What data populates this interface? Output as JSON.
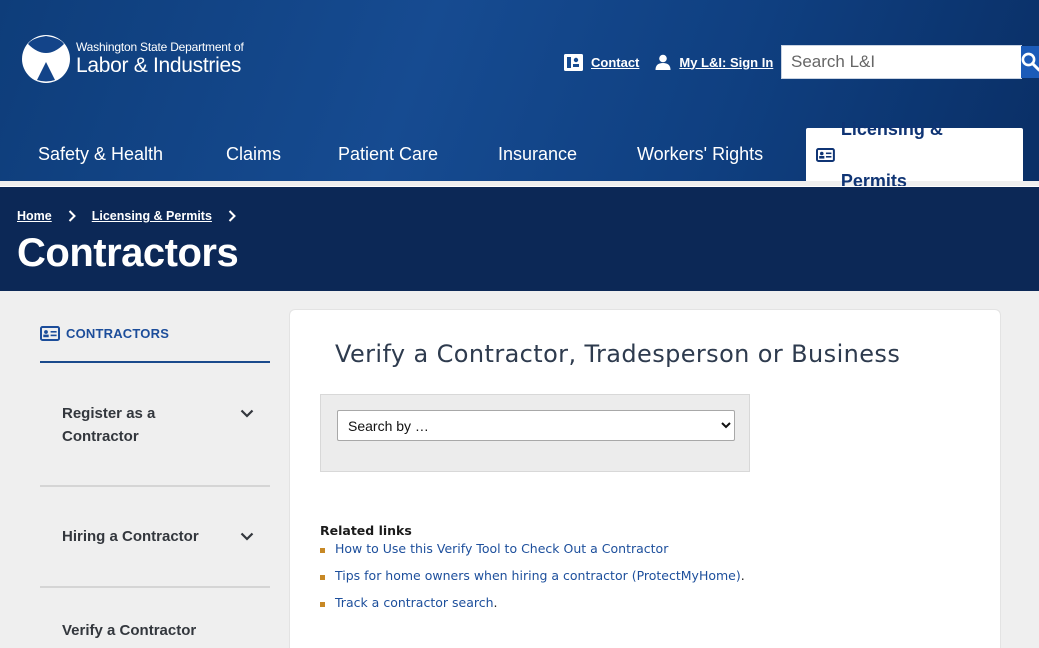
{
  "header": {
    "logo_small": "Washington State Department of",
    "logo_big": "Labor & Industries",
    "contact_label": "Contact",
    "signin_label": "My L&I: Sign In",
    "search_placeholder": "Search L&I"
  },
  "nav": {
    "items": [
      {
        "label": "Safety & Health"
      },
      {
        "label": "Claims"
      },
      {
        "label": "Patient Care"
      },
      {
        "label": "Insurance"
      },
      {
        "label": "Workers' Rights"
      },
      {
        "label": "Licensing & Permits"
      }
    ],
    "active_index": 5
  },
  "breadcrumb": {
    "items": [
      {
        "label": "Home"
      },
      {
        "label": "Licensing & Permits"
      }
    ]
  },
  "page_title": "Contractors",
  "sidebar": {
    "heading": "CONTRACTORS",
    "items": [
      {
        "label": "Register as a Contractor"
      },
      {
        "label": "Hiring a Contractor"
      },
      {
        "label": "Verify a Contractor"
      }
    ]
  },
  "main": {
    "title": "Verify a Contractor, Tradesperson or Business",
    "search_select": "Search by …",
    "related_heading": "Related links",
    "related_links": [
      {
        "label": "How to Use this Verify Tool to Check Out a Contractor",
        "suffix": ""
      },
      {
        "label": "Tips for home owners when hiring a contractor (ProtectMyHome)",
        "suffix": "."
      },
      {
        "label": "Track a contractor search",
        "suffix": "."
      }
    ]
  },
  "colors": {
    "header_blue": "#164b91",
    "hero_navy": "#0c2856",
    "accent_link": "#1d4f9c",
    "bullet": "#c78825"
  }
}
